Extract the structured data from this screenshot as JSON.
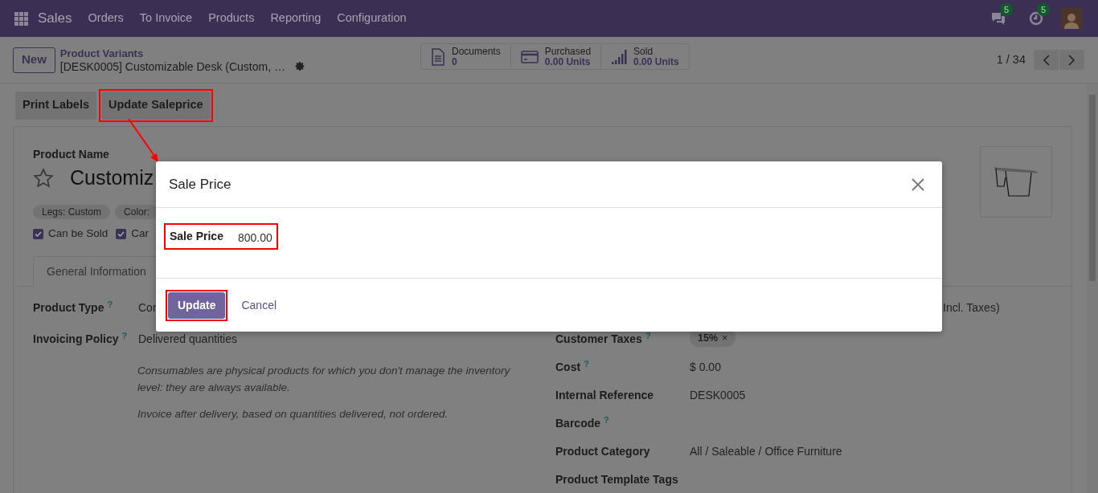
{
  "navbar": {
    "app": "Sales",
    "menu": [
      "Orders",
      "To Invoice",
      "Products",
      "Reporting",
      "Configuration"
    ],
    "chat_badge": "5",
    "activity_badge": "5"
  },
  "control_panel": {
    "new_button": "New",
    "breadcrumb_parent": "Product Variants",
    "record_title": "[DESK0005] Customizable Desk (Custom, …",
    "pager": "1 / 34",
    "stats": [
      {
        "kind": "document",
        "label": "Documents",
        "value": "0"
      },
      {
        "kind": "card",
        "label": "Purchased",
        "value": "0.00 Units"
      },
      {
        "kind": "bars",
        "label": "Sold",
        "value": "0.00 Units"
      }
    ]
  },
  "actions": [
    {
      "label": "Print Labels",
      "highlighted": false
    },
    {
      "label": "Update Saleprice",
      "highlighted": true
    }
  ],
  "form": {
    "name_label": "Product Name",
    "name": "Customiz",
    "favorite": false,
    "attributes": [
      "Legs: Custom",
      "Color:"
    ],
    "checkboxes": [
      {
        "label": "Can be Sold",
        "checked": true
      },
      {
        "label": "Car",
        "checked": true
      }
    ],
    "tabs": [
      {
        "label": "General Information",
        "selected": true
      }
    ],
    "left_fields": [
      {
        "label": "Product Type",
        "help": "?",
        "value": "Cor"
      },
      {
        "label": "Invoicing Policy",
        "help": "?",
        "value": "Delivered quantities"
      }
    ],
    "notes": [
      "Consumables are physical products for which you don't manage the inventory level: they are always available.",
      "Invoice after delivery, based on quantities delivered, not ordered."
    ],
    "sales_price_suffix": "Incl. Taxes)",
    "right_fields": [
      {
        "kind": "tag",
        "label": "Customer Taxes",
        "help": "?",
        "value": "15%",
        "remove": "×"
      },
      {
        "kind": "text",
        "label": "Cost",
        "help": "?",
        "value": "$ 0.00"
      },
      {
        "kind": "text",
        "label": "Internal Reference",
        "value": "DESK0005"
      },
      {
        "kind": "text",
        "label": "Barcode",
        "help": "?"
      },
      {
        "kind": "text",
        "label": "Product Category",
        "value": "All / Saleable / Office Furniture"
      },
      {
        "kind": "text",
        "label": "Product Template Tags"
      }
    ]
  },
  "dialog": {
    "title": "Sale Price",
    "field_label": "Sale Price",
    "field_value": "800.00",
    "field_highlighted": true,
    "buttons": [
      {
        "kind": "primary",
        "label": "Update",
        "highlighted": true
      },
      {
        "kind": "link",
        "label": "Cancel",
        "highlighted": false
      }
    ]
  }
}
